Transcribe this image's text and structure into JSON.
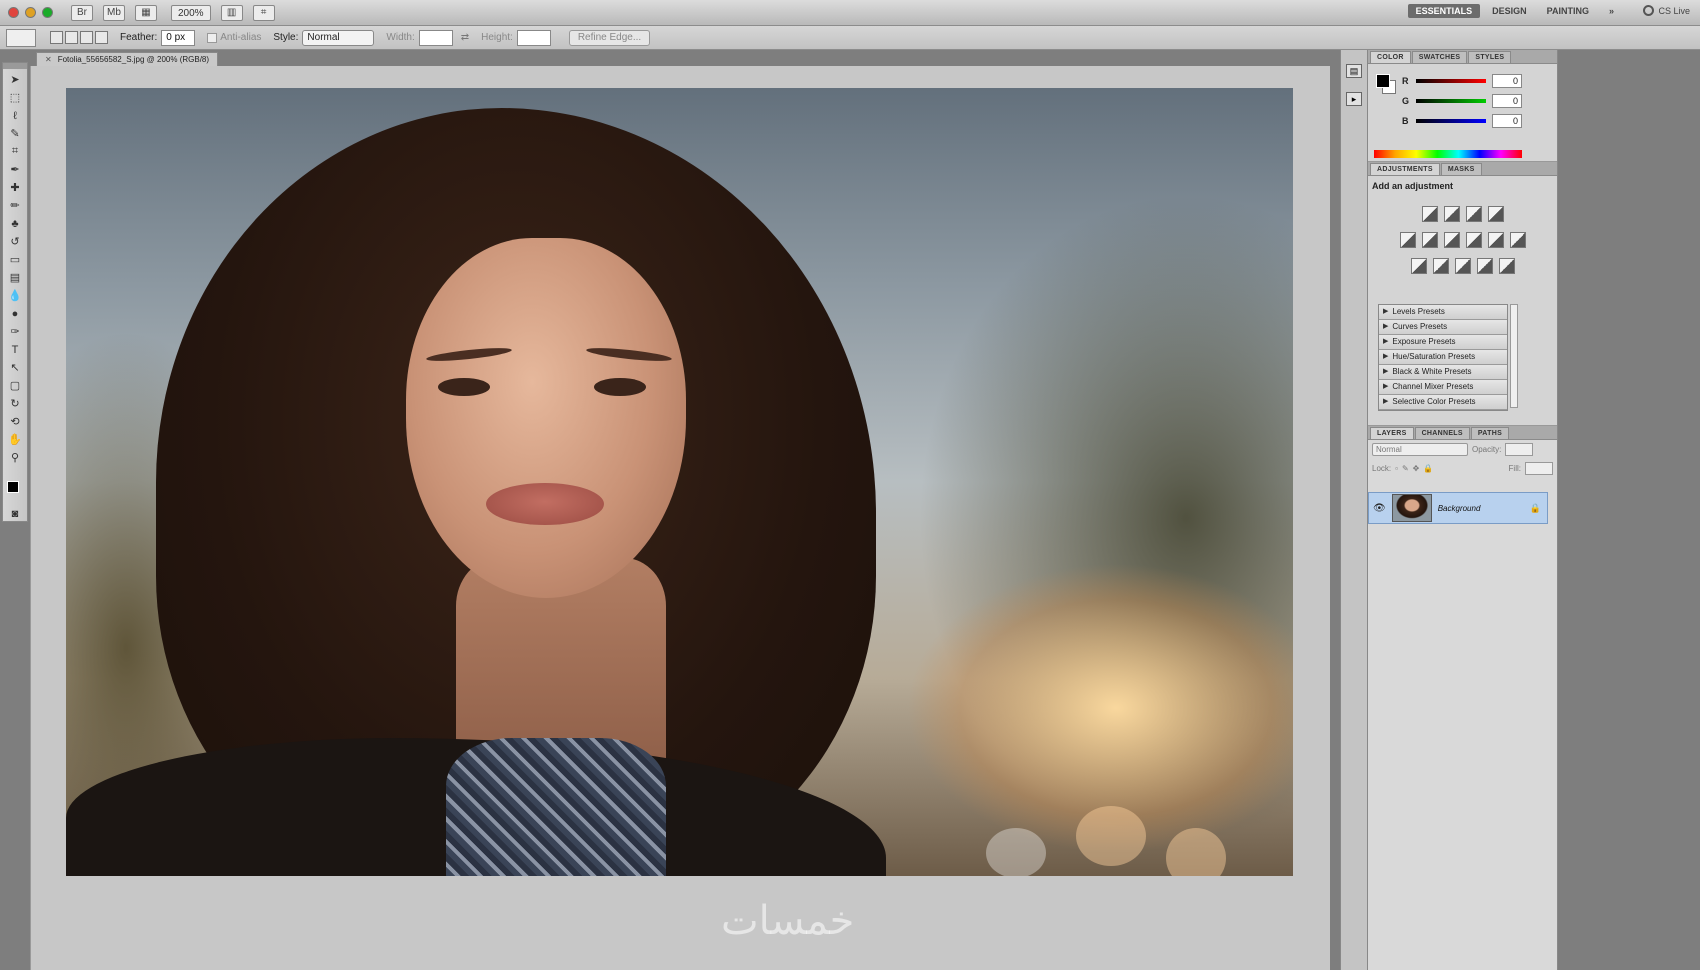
{
  "app": {
    "zoom": "200%",
    "workspaces": [
      "ESSENTIALS",
      "DESIGN",
      "PAINTING",
      "»"
    ],
    "active_workspace": "ESSENTIALS",
    "cs_live": "CS Live"
  },
  "options": {
    "feather_label": "Feather:",
    "feather_value": "0 px",
    "anti_alias": "Anti-alias",
    "style_label": "Style:",
    "style_value": "Normal",
    "width_label": "Width:",
    "height_label": "Height:",
    "refine_edge": "Refine Edge..."
  },
  "document": {
    "tab_title": "Fotolia_55656582_S.jpg @ 200% (RGB/8)",
    "watermark": "خمسات"
  },
  "panels": {
    "color_tabs": [
      "COLOR",
      "SWATCHES",
      "STYLES"
    ],
    "color": {
      "r_label": "R",
      "r_value": "0",
      "g_label": "G",
      "g_value": "0",
      "b_label": "B",
      "b_value": "0"
    },
    "adjust_tabs": [
      "ADJUSTMENTS",
      "MASKS"
    ],
    "adjust_title": "Add an adjustment",
    "presets": [
      "Levels Presets",
      "Curves Presets",
      "Exposure Presets",
      "Hue/Saturation Presets",
      "Black & White Presets",
      "Channel Mixer Presets",
      "Selective Color Presets"
    ],
    "layers_tabs": [
      "LAYERS",
      "CHANNELS",
      "PATHS"
    ],
    "blend_mode": "Normal",
    "opacity_label": "Opacity:",
    "lock_label": "Lock:",
    "fill_label": "Fill:",
    "layer_name": "Background"
  },
  "colors": {
    "accent_selection": "#b8d1ee",
    "panel_bg": "#d4d4d4"
  }
}
